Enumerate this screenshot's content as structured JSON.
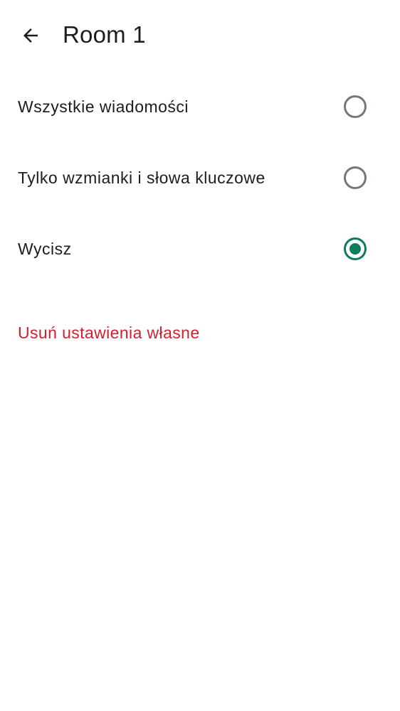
{
  "header": {
    "title": "Room 1",
    "back_icon": "arrow-left-icon"
  },
  "options": [
    {
      "label": "Wszystkie wiadomości",
      "selected": false
    },
    {
      "label": "Tylko wzmianki i słowa kluczowe",
      "selected": false
    },
    {
      "label": "Wycisz",
      "selected": true
    }
  ],
  "reset": {
    "label": "Usuń ustawienia własne"
  },
  "colors": {
    "accent": "#0b7c5e",
    "danger": "#d1202f",
    "text": "#1b1d21",
    "radio_unselected": "#737880"
  }
}
